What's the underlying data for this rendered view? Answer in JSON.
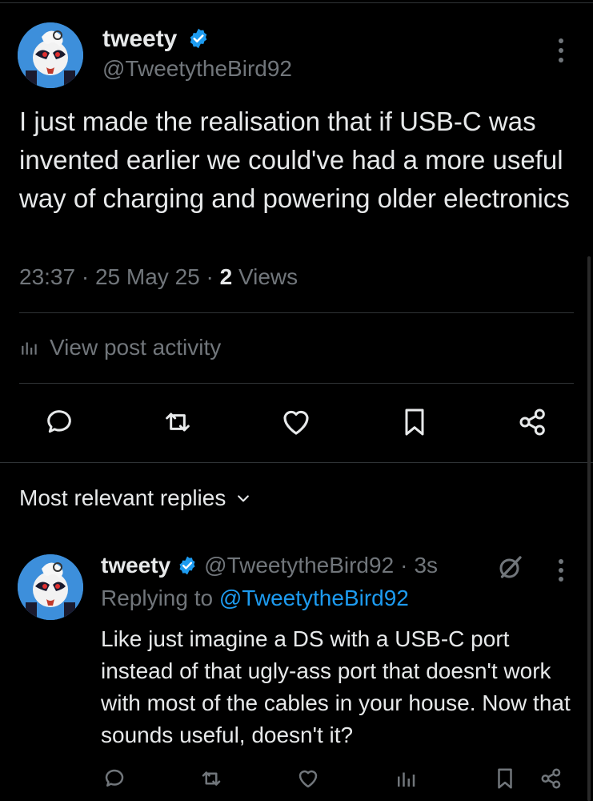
{
  "post": {
    "author_name": "tweety",
    "author_handle": "@TweetytheBird92",
    "text": "I just made the realisation that if USB-C was invented earlier we could've had a more useful way of charging and powering older electronics",
    "time": "23:37",
    "separator1": "·",
    "date": "25 May 25",
    "separator2": "·",
    "views_count": "2",
    "views_label": "Views",
    "activity_label": "View post activity"
  },
  "replies_section": {
    "sort_label": "Most relevant replies"
  },
  "reply": {
    "author_name": "tweety",
    "author_handle": "@TweetytheBird92",
    "separator": "·",
    "age": "3s",
    "replying_prefix": "Replying to",
    "replying_handle": "@TweetytheBird92",
    "text": "Like just imagine a DS with a USB-C port instead of that ugly-ass port that doesn't work with most of the cables in your house. Now that sounds useful, doesn't it?"
  },
  "colors": {
    "background": "#000000",
    "text": "#e7e9ea",
    "muted": "#71767b",
    "accent": "#1d9bf0",
    "divider": "#2f3336"
  },
  "icons": [
    "verified-badge-icon",
    "more-icon",
    "bar-chart-icon",
    "reply-icon",
    "retweet-icon",
    "like-icon",
    "bookmark-icon",
    "share-icon",
    "chevron-down-icon",
    "grok-icon",
    "views-icon"
  ]
}
